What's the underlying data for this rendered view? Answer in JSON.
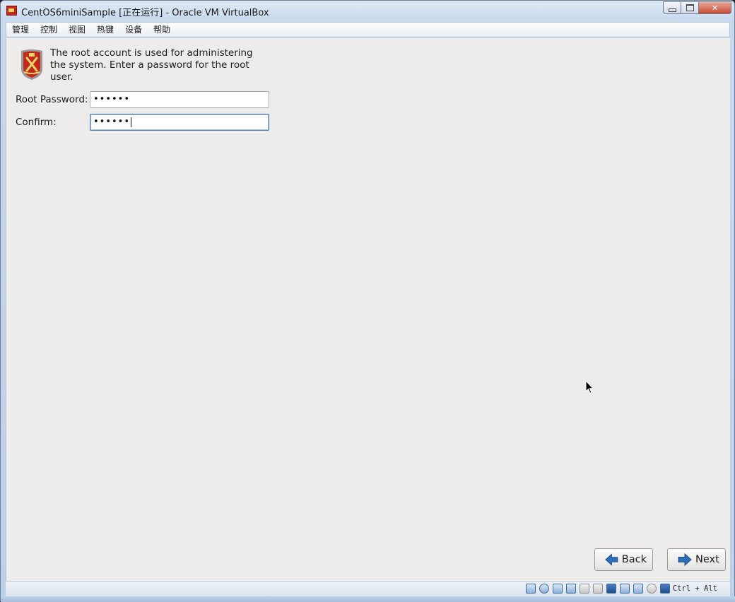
{
  "window": {
    "title": "CentOS6miniSample [正在运行] - Oracle VM VirtualBox",
    "controls": {
      "close": "✕"
    }
  },
  "menu": [
    "管理",
    "控制",
    "视图",
    "热键",
    "设备",
    "帮助"
  ],
  "installer": {
    "intro_text": "The root account is used for administering the system.  Enter a password for the root user.",
    "root_password_label": "Root Password:",
    "root_password_value": "••••••",
    "confirm_label": "Confirm:",
    "confirm_value": "••••••",
    "back_label": "Back",
    "next_label": "Next"
  },
  "statusbar": {
    "icons": [
      "hard-disk-icon",
      "optical-drive-icon",
      "audio-icon",
      "network-icon",
      "usb-icon",
      "shared-folders-icon",
      "display-icon",
      "video-capture-icon",
      "cpu-icon",
      "mouse-integration-icon",
      "keyboard-capture-icon"
    ],
    "host_key": "Ctrl + Alt"
  },
  "colors": {
    "vm_background": "#edeceb",
    "arrow_blue": "#2f6fb8",
    "shield_red": "#c4281b"
  }
}
